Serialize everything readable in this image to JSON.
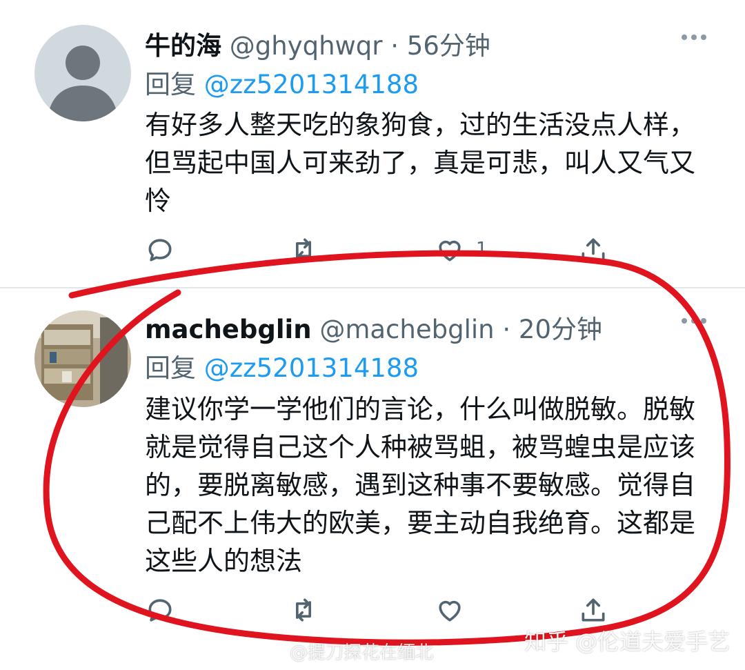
{
  "tweets": [
    {
      "display_name": "牛的海",
      "handle": "@ghyqhwqr",
      "separator": "·",
      "time": "56分钟",
      "reply_label": "回复",
      "reply_to": "@zz5201314188",
      "body": "有好多人整天吃的象狗食，过的生活没点人样，但骂起中国人可来劲了，真是可悲，叫人又气又怜",
      "like_count": "1",
      "avatar": "default-avatar"
    },
    {
      "display_name": "machebglin",
      "handle": "@machebglin",
      "separator": "·",
      "time": "20分钟",
      "reply_label": "回复",
      "reply_to": "@zz5201314188",
      "body": "建议你学一学他们的言论，什么叫做脱敏。脱敏就是觉得自己这个人种被骂蛆，被骂蝗虫是应该的，要脱离敏感，遇到这种事不要敏感。觉得自己配不上伟大的欧美，要主动自我绝育。这都是这些人的想法",
      "avatar": "photo-avatar"
    }
  ],
  "watermarks": {
    "zhihu": "知乎 @伦道夫爱手艺",
    "weibo": "@提刀探花在缅北"
  },
  "colors": {
    "accent": "#1d9bf0",
    "secondary_text": "#536471",
    "annotation_red": "#e0141e"
  },
  "icons": [
    "reply-icon",
    "retweet-icon",
    "like-icon",
    "share-icon",
    "more-icon"
  ]
}
